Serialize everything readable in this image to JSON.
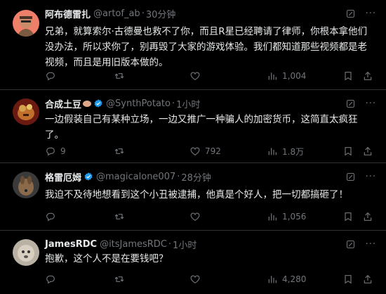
{
  "tweets": [
    {
      "name": "阿布德雷扎",
      "handle": "@artof_ab",
      "time": "30分钟",
      "text": "兄弟，就算索尔·古德曼也救不了你，而且R星已经聘请了律师，你根本拿他们没办法，所以求你了，别再毁了大家的游戏体验。我们都知道那些视频都是老视频，而且是用旧版本做的。",
      "replies": "",
      "retweets": "",
      "likes": "",
      "views": "1,004",
      "verified": false
    },
    {
      "name": "合成土豆",
      "handle": "@SynthPotato",
      "time": "1小时",
      "text": "一边假装自己有某种立场，一边又推广一种骗人的加密货币，这简直太疯狂了。",
      "replies": "9",
      "retweets": "",
      "likes": "792",
      "views": "1.8万",
      "verified": true
    },
    {
      "name": "格雷厄姆",
      "handle": "@magicalone007",
      "time": "28分钟",
      "text": "我迫不及待地想看到这个小丑被逮捕，他真是个好人，把一切都搞砸了！",
      "replies": "",
      "retweets": "",
      "likes": "",
      "views": "1,056",
      "verified": true
    },
    {
      "name": "JamesRDC",
      "handle": "@itsJamesRDC",
      "time": "1小时",
      "text": "抱歉，这个人不是在要钱吧？",
      "replies": "",
      "retweets": "",
      "likes": "",
      "views": "4,280",
      "verified": false
    }
  ],
  "icons": {
    "reply": "reply-icon",
    "retweet": "retweet-icon",
    "like": "like-icon",
    "views": "views-icon",
    "bookmark": "bookmark-icon",
    "share": "share-icon",
    "grok": "grok-icon",
    "more": "more-icon"
  },
  "colors": {
    "background": "#000000",
    "muted": "#71767b",
    "text": "#e7e9ea",
    "verified": "#1d9bf0",
    "divider": "#2f3336"
  }
}
